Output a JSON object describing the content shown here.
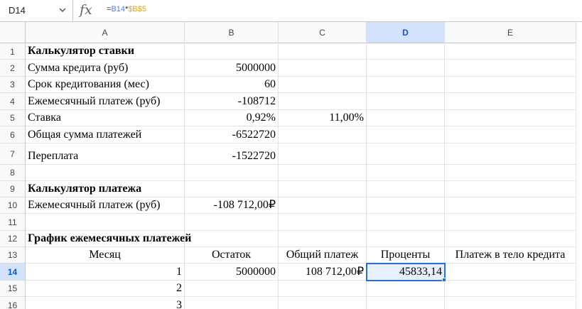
{
  "formula_bar": {
    "cell_ref": "D14",
    "fx_label": "fx",
    "formula_parts": [
      "=",
      "B14",
      "*",
      "$B$5"
    ]
  },
  "columns": [
    "A",
    "B",
    "C",
    "D",
    "E"
  ],
  "rows": [
    "1",
    "2",
    "3",
    "4",
    "5",
    "6",
    "7",
    "8",
    "9",
    "10",
    "11",
    "12",
    "13",
    "14",
    "15",
    "16"
  ],
  "selection": {
    "column": "D",
    "row": "14"
  },
  "cells": {
    "A1": "Калькулятор ставки",
    "A2": "Сумма кредита (руб)",
    "B2": "5000000",
    "A3": "Срок кредитования (мес)",
    "B3": "60",
    "A4": "Ежемесячный платеж (руб)",
    "B4": "-108712",
    "A5": "Ставка",
    "B5": "0,92%",
    "C5": "11,00%",
    "A6": "Общая сумма платежей",
    "B6": "-6522720",
    "A7": "Переплата",
    "B7": "-1522720",
    "A9": "Калькулятор платежа",
    "A10": "Ежемесячный платеж (руб)",
    "B10": "-108 712,00₽",
    "A12": "График ежемесячных платежей",
    "A13": "Месяц",
    "B13": "Остаток",
    "C13": "Общий платеж",
    "D13": "Проценты",
    "E13": "Платеж в тело кредита",
    "A14": "1",
    "B14": "5000000",
    "C14": "108 712,00₽",
    "D14": "45833,14",
    "A15": "2",
    "A16": "3"
  }
}
